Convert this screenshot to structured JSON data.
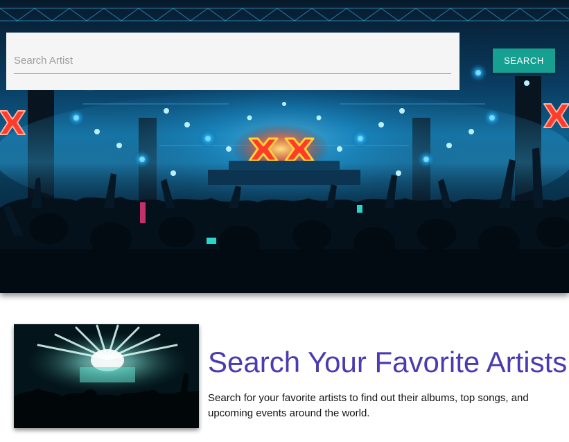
{
  "search": {
    "placeholder": "Search Artist",
    "value": "",
    "button_label": "SEARCH"
  },
  "intro": {
    "title": "Search Your Favorite Artists",
    "description": "Search for your favorite artists to find out their albums, top songs, and upcoming events around the world."
  },
  "icons": {
    "hero": "concert-stage-crowd-image",
    "feature": "concert-lights-image"
  },
  "colors": {
    "accent_button": "#16a091",
    "title_purple": "#4a3bb0",
    "stage_blue": "#2bb8ff",
    "stage_red": "#ff3b2a",
    "stage_yellow": "#ffd23a"
  }
}
